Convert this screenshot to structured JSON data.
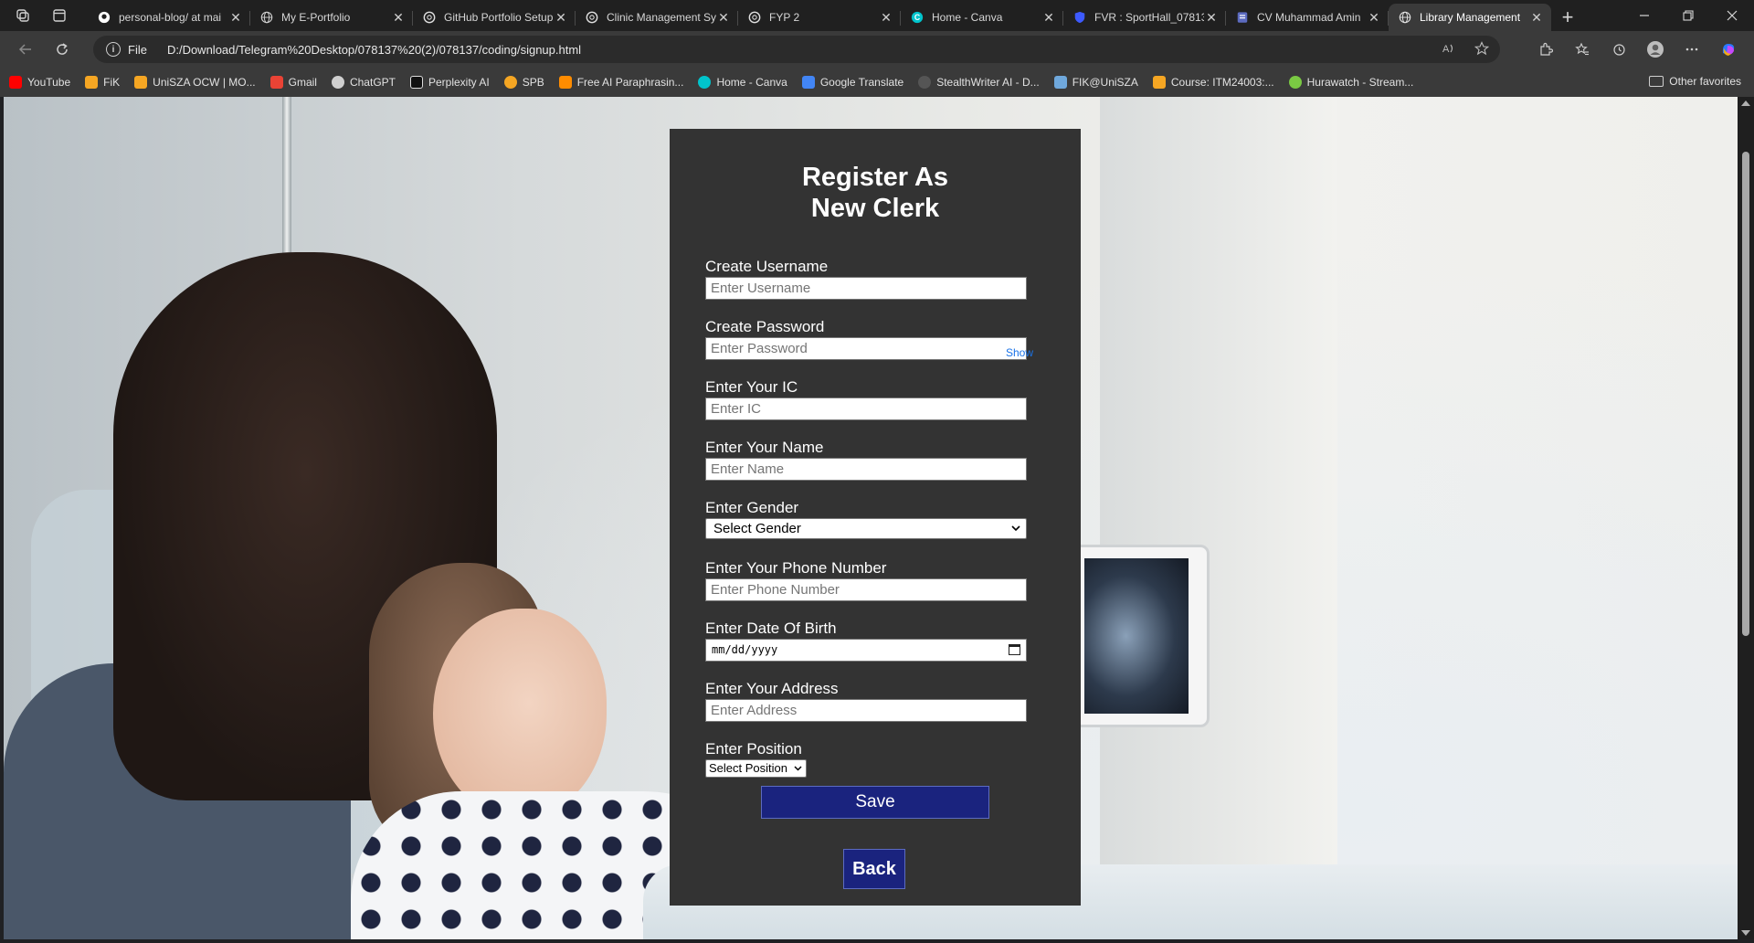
{
  "browser": {
    "tabs": [
      {
        "title": "personal-blog/ at mai",
        "icon": "github-icon"
      },
      {
        "title": "My E-Portfolio",
        "icon": "globe-icon"
      },
      {
        "title": "GitHub Portfolio Setup",
        "icon": "chatgpt-icon"
      },
      {
        "title": "Clinic Management Sy",
        "icon": "chatgpt-icon"
      },
      {
        "title": "FYP 2",
        "icon": "chatgpt-icon"
      },
      {
        "title": "Home - Canva",
        "icon": "canva-icon"
      },
      {
        "title": "FVR : SportHall_07813",
        "icon": "shield-icon"
      },
      {
        "title": "CV Muhammad Amin",
        "icon": "doc-icon"
      },
      {
        "title": "Library Management",
        "icon": "globe-icon",
        "active": true
      }
    ],
    "close_glyph": "✕",
    "newtab_glyph": "+",
    "address": {
      "scheme_label": "File",
      "url": "D:/Download/Telegram%20Desktop/078137%20(2)/078137/coding/signup.html"
    },
    "bookmarks": [
      {
        "label": "YouTube",
        "color": "#ff0000"
      },
      {
        "label": "FiK",
        "color": "#f5a623"
      },
      {
        "label": "UniSZA OCW | MO...",
        "color": "#f5a623"
      },
      {
        "label": "Gmail",
        "color": "#ea4335"
      },
      {
        "label": "ChatGPT",
        "color": "#cfcfcf"
      },
      {
        "label": "Perplexity AI",
        "color": "#222222"
      },
      {
        "label": "SPB",
        "color": "#f5a623"
      },
      {
        "label": "Free AI Paraphrasin...",
        "color": "#ff8c00"
      },
      {
        "label": "Home - Canva",
        "color": "#00c4cc"
      },
      {
        "label": "Google Translate",
        "color": "#4285f4"
      },
      {
        "label": "StealthWriter AI - D...",
        "color": "#555555"
      },
      {
        "label": "FIK@UniSZA",
        "color": "#6fa8dc"
      },
      {
        "label": "Course: ITM24003:...",
        "color": "#f5a623"
      },
      {
        "label": "Hurawatch - Stream...",
        "color": "#7ac943"
      }
    ],
    "other_favorites": "Other favorites"
  },
  "form": {
    "title_line1": "Register As",
    "title_line2": "New Clerk",
    "username": {
      "label": "Create Username",
      "placeholder": "Enter Username"
    },
    "password": {
      "label": "Create Password",
      "placeholder": "Enter Password",
      "toggle": "Show"
    },
    "ic": {
      "label": "Enter Your IC",
      "placeholder": "Enter IC"
    },
    "name": {
      "label": "Enter Your Name",
      "placeholder": "Enter Name"
    },
    "gender": {
      "label": "Enter Gender",
      "selected": "Select Gender"
    },
    "phone": {
      "label": "Enter Your Phone Number",
      "placeholder": "Enter Phone Number"
    },
    "dob": {
      "label": "Enter Date Of Birth",
      "placeholder": "mm/dd/yyyy"
    },
    "address": {
      "label": "Enter Your Address",
      "placeholder": "Enter Address"
    },
    "position": {
      "label": "Enter Position",
      "selected": "Select Position"
    },
    "save_label": "Save",
    "back_label": "Back"
  },
  "colors": {
    "panel": "#333333",
    "button": "#1a237e",
    "link": "#1a73e8"
  }
}
